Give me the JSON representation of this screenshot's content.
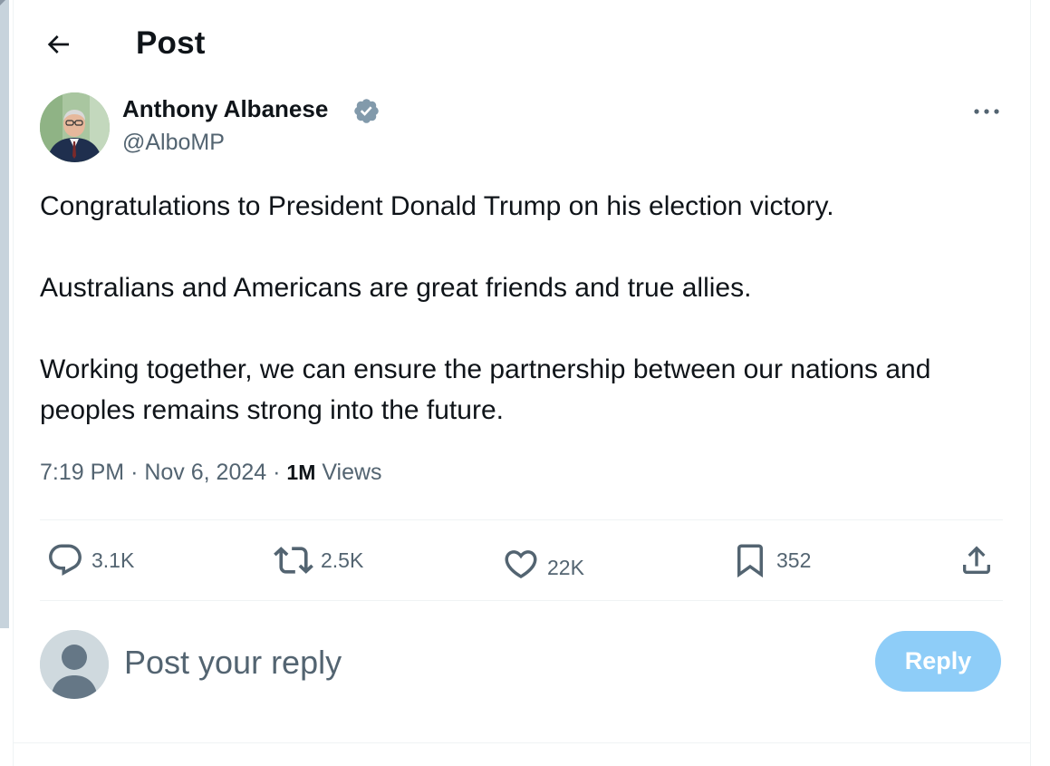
{
  "header": {
    "back_icon": "arrow-left-icon",
    "title": "Post"
  },
  "author": {
    "name": "Anthony Albanese",
    "handle": "@AlboMP",
    "verified_icon": "verified-badge-icon",
    "verified_color": "#829aab"
  },
  "post": {
    "paragraphs": [
      "Congratulations to President Donald Trump on his election victory.",
      "Australians and Americans are great friends and true allies.",
      "Working together, we can ensure the partnership between our nations and peoples remains strong into the future."
    ],
    "time": "7:19 PM",
    "separator": "·",
    "date": "Nov 6, 2024",
    "views_count": "1M",
    "views_label": "Views"
  },
  "actions": {
    "replies": {
      "icon": "reply-bubble-icon",
      "count": "3.1K"
    },
    "reposts": {
      "icon": "repost-icon",
      "count": "2.5K"
    },
    "likes": {
      "icon": "heart-icon",
      "count": "22K"
    },
    "bookmarks": {
      "icon": "bookmark-icon",
      "count": "352"
    },
    "share": {
      "icon": "share-upload-icon"
    }
  },
  "reply_box": {
    "placeholder": "Post your reply",
    "button_label": "Reply",
    "button_color": "#8ecdf8"
  },
  "colors": {
    "text_primary": "#0f1419",
    "text_secondary": "#536471",
    "divider": "#eff3f4"
  }
}
